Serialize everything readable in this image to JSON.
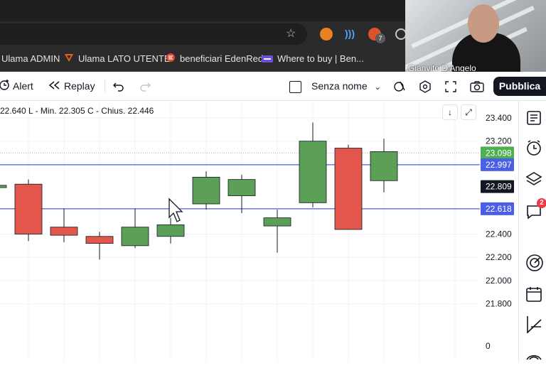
{
  "browser": {
    "bookmarks": [
      {
        "label": "Ulama ADMIN"
      },
      {
        "label": "Ulama LATO UTENTE"
      },
      {
        "label": "beneficiari EdenRed"
      },
      {
        "label": "Where to buy | Ben..."
      }
    ],
    "extension_badge": "7"
  },
  "webcam": {
    "participant_name": "Gianvito D'Angelo"
  },
  "toolbar": {
    "alert_label": "Alert",
    "replay_label": "Replay",
    "layout_name": "Senza nome",
    "publish_label": "Pubblica"
  },
  "ohlc": {
    "text": "22.640  L - Min. 22.305  C - Chius. 22.446"
  },
  "right_panel": {
    "notification_count": "2"
  },
  "chart_data": {
    "type": "candlestick",
    "y_ticks": [
      "23.400",
      "23.200",
      "22.400",
      "22.200",
      "22.000",
      "21.800",
      "0"
    ],
    "y_ticks_values": [
      23.4,
      23.2,
      22.4,
      22.2,
      22.0,
      21.8
    ],
    "bottom_label": "0",
    "price_labels": [
      {
        "value": 23.098,
        "text": "23.098",
        "color": "#4caf50"
      },
      {
        "value": 22.997,
        "text": "22.997",
        "color": "#4a5ee6"
      },
      {
        "value": 22.809,
        "text": "22.809",
        "color": "#131722"
      },
      {
        "value": 22.618,
        "text": "22.618",
        "color": "#4a5ee6"
      }
    ],
    "horizontal_lines": [
      22.997,
      22.618
    ],
    "dotted_level": 23.098,
    "candles": [
      {
        "open": 22.8,
        "close": 22.82,
        "high": 22.86,
        "low": 22.78
      },
      {
        "open": 22.83,
        "close": 22.4,
        "high": 22.87,
        "low": 22.34
      },
      {
        "open": 22.46,
        "close": 22.39,
        "high": 22.62,
        "low": 22.33
      },
      {
        "open": 22.38,
        "close": 22.32,
        "high": 22.42,
        "low": 22.18
      },
      {
        "open": 22.3,
        "close": 22.46,
        "high": 22.62,
        "low": 22.28
      },
      {
        "open": 22.38,
        "close": 22.48,
        "high": 22.54,
        "low": 22.32
      },
      {
        "open": 22.66,
        "close": 22.89,
        "high": 22.94,
        "low": 22.61
      },
      {
        "open": 22.73,
        "close": 22.87,
        "high": 22.91,
        "low": 22.58
      },
      {
        "open": 22.47,
        "close": 22.54,
        "high": 22.61,
        "low": 22.24
      },
      {
        "open": 22.67,
        "close": 23.2,
        "high": 23.36,
        "low": 22.63
      },
      {
        "open": 23.14,
        "close": 22.44,
        "high": 23.17,
        "low": 22.44
      },
      {
        "open": 22.86,
        "close": 23.11,
        "high": 23.22,
        "low": 22.76
      }
    ],
    "colors": {
      "up": "#5c9f56",
      "down": "#e2564c",
      "grid": "#f0f3fa"
    }
  }
}
